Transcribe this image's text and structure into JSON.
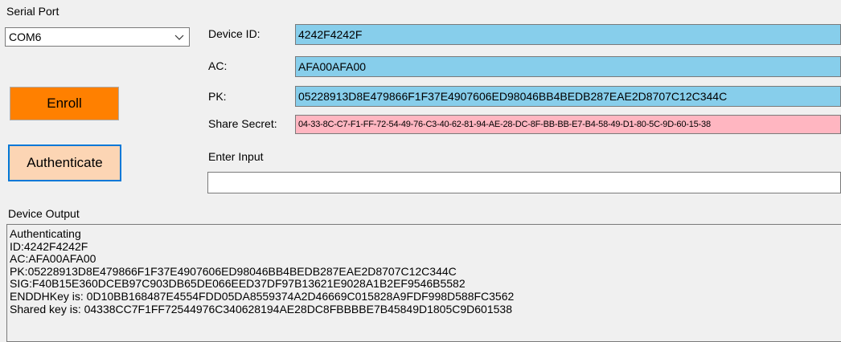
{
  "serial_port": {
    "label": "Serial Port",
    "selected": "COM6"
  },
  "buttons": {
    "enroll": "Enroll",
    "authenticate": "Authenticate"
  },
  "fields": {
    "device_id": {
      "label": "Device ID:",
      "value": "4242F4242F"
    },
    "ac": {
      "label": "AC:",
      "value": "AFA00AFA00"
    },
    "pk": {
      "label": "PK:",
      "value": "05228913D8E479866F1F37E4907606ED98046BB4BEDB287EAE2D8707C12C344C"
    },
    "share_secret": {
      "label": "Share Secret:",
      "value": "04-33-8C-C7-F1-FF-72-54-49-76-C3-40-62-81-94-AE-28-DC-8F-BB-BB-E7-B4-58-49-D1-80-5C-9D-60-15-38"
    },
    "enter_input": {
      "label": "Enter Input",
      "value": ""
    }
  },
  "device_output": {
    "label": "Device Output",
    "lines": [
      "Authenticating",
      "ID:4242F4242F",
      "AC:AFA00AFA00",
      "PK:05228913D8E479866F1F37E4907606ED98046BB4BEDB287EAE2D8707C12C344C",
      "SIG:F40B15E360DCEB97C903DB65DE066EED37DF97B13621E9028A1B2EF9546B5582",
      "ENDDHKey is: 0D10BB168487E4554FDD05DA8559374A2D46669C015828A9FDF998D588FC3562",
      "Shared key is: 04338CC7F1FF72544976C340628194AE28DC8FBBBBE7B45849D1805C9D601538"
    ]
  },
  "colors": {
    "enroll_button": "#ff8000",
    "authenticate_button": "#fcd5b4",
    "field_blue": "#87ceeb",
    "field_pink": "#ffb6c1",
    "focus_border": "#0078d7"
  }
}
